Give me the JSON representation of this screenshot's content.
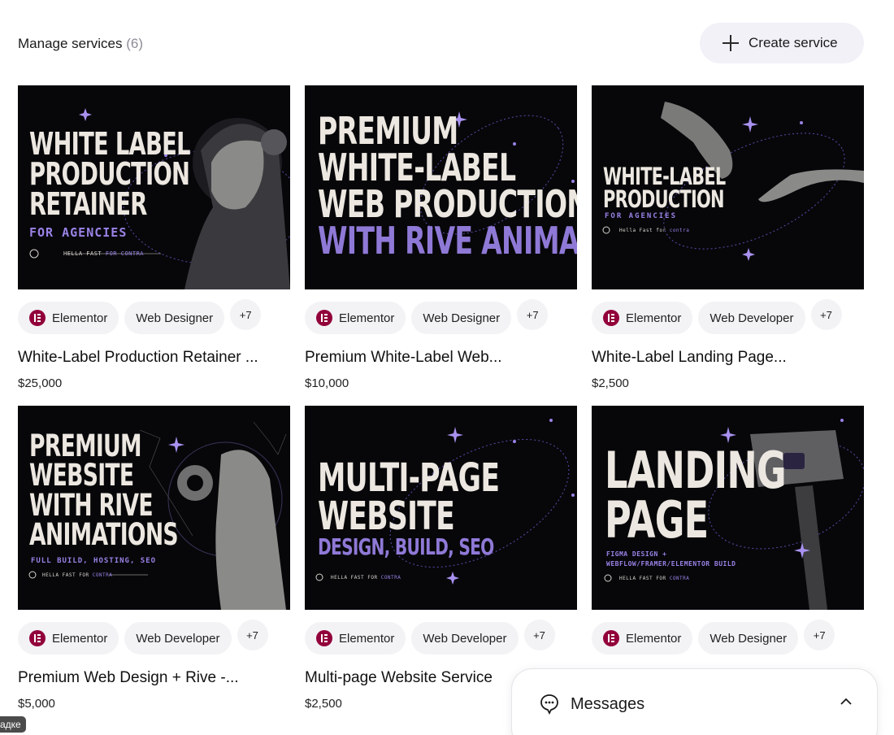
{
  "header": {
    "title": "Manage services",
    "count": "(6)",
    "create_label": "Create service"
  },
  "services": [
    {
      "thumb": {
        "lines": [
          "WHITE LABEL",
          "PRODUCTION",
          "RETAINER"
        ],
        "sub": "FOR AGENCIES",
        "foot": "HELLA FAST",
        "foot_accent": "FOR CONTRA"
      },
      "tags": [
        "Elementor",
        "Web Designer"
      ],
      "more": "+7",
      "title": "White-Label Production Retainer ...",
      "price": "$25,000"
    },
    {
      "thumb": {
        "lines": [
          "PREMIUM",
          "WHITE-LABEL",
          "WEB PRODUCTION"
        ],
        "accent_line": "WITH RIVE ANIMATIONS"
      },
      "tags": [
        "Elementor",
        "Web Designer"
      ],
      "more": "+7",
      "title": "Premium White-Label Web...",
      "price": "$10,000"
    },
    {
      "thumb": {
        "lines": [
          "WHITE-LABEL",
          "PRODUCTION"
        ],
        "sub": "FOR AGENCIES",
        "foot": "Hella Fast for",
        "foot_accent": "contra"
      },
      "tags": [
        "Elementor",
        "Web Developer"
      ],
      "more": "+7",
      "title": "White-Label Landing Page...",
      "price": "$2,500"
    },
    {
      "thumb": {
        "lines": [
          "PREMIUM",
          "WEBSITE",
          "WITH RIVE",
          "ANIMATIONS"
        ],
        "sub": "FULL BUILD, HOSTING, SEO",
        "foot": "HELLA FAST FOR",
        "foot_accent": "CONTRA"
      },
      "tags": [
        "Elementor",
        "Web Developer"
      ],
      "more": "+7",
      "title": "Premium Web Design + Rive -...",
      "price": "$5,000"
    },
    {
      "thumb": {
        "lines": [
          "MULTI-PAGE",
          "WEBSITE"
        ],
        "accent_line": "DESIGN, BUILD, SEO",
        "foot": "HELLA FAST FOR",
        "foot_accent": "CONTRA"
      },
      "tags": [
        "Elementor",
        "Web Developer"
      ],
      "more": "+7",
      "title": "Multi-page Website Service",
      "price": "$2,500"
    },
    {
      "thumb": {
        "lines": [
          "LANDING",
          "PAGE"
        ],
        "sub": "FIGMA DESIGN +",
        "sub2": "WEBFLOW/FRAMER/ELEMENTOR BUILD",
        "foot": "HELLA FAST FOR",
        "foot_accent": "CONTRA"
      },
      "tags": [
        "Elementor",
        "Web Designer"
      ],
      "more": "+7",
      "title": "",
      "price": ""
    }
  ],
  "messages": {
    "label": "Messages"
  },
  "status_pill": "адке",
  "colors": {
    "accent": "#8f79d6",
    "brand_elementor": "#92003b",
    "chip_bg": "#f3f2f5"
  }
}
